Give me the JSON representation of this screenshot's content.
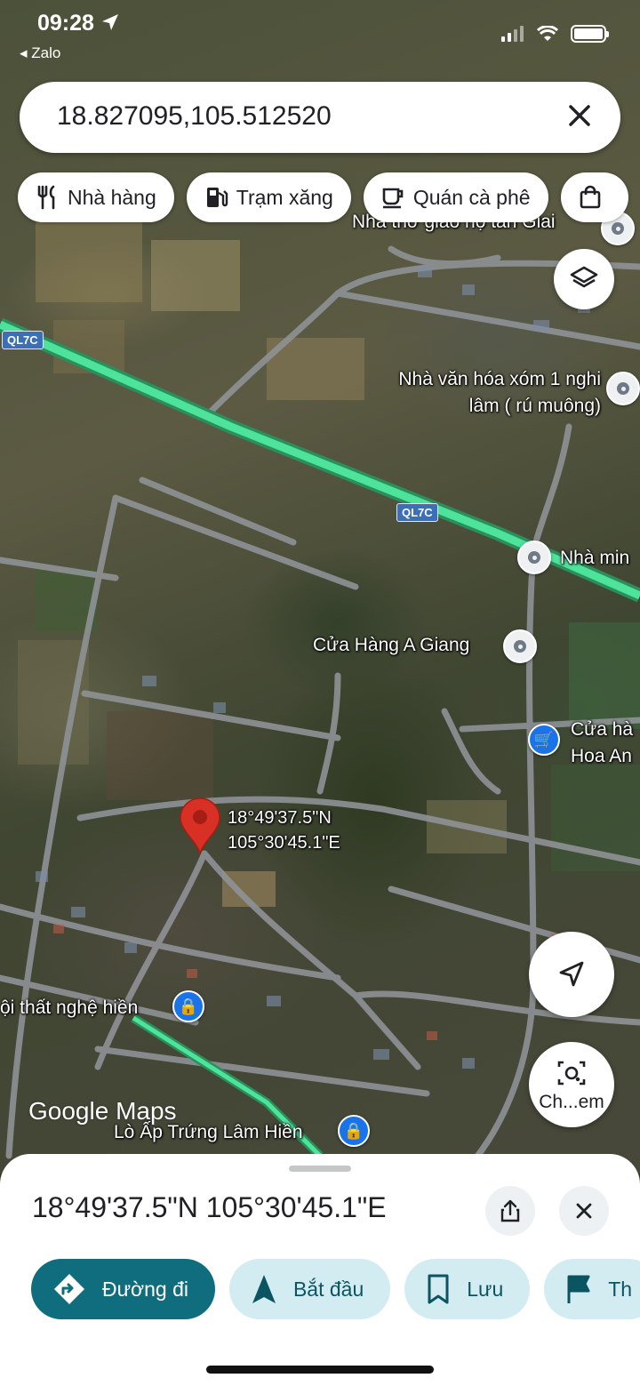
{
  "status_bar": {
    "time": "09:28",
    "back_app": "Zalo"
  },
  "search": {
    "query": "18.827095,105.512520"
  },
  "chips": [
    {
      "label": "Nhà hàng",
      "icon": "restaurant-icon"
    },
    {
      "label": "Trạm xăng",
      "icon": "gas-station-icon"
    },
    {
      "label": "Quán cà phê",
      "icon": "coffee-icon"
    },
    {
      "label": "",
      "icon": "shopping-bag-icon"
    }
  ],
  "map": {
    "road_labels": [
      "QL7C",
      "QL7C"
    ],
    "places": [
      "Nhà thờ giáo họ tân Giai",
      "Nhà văn hóa xóm 1 nghi lâm ( rú muông)",
      "Nhà min",
      "Cửa Hàng A Giang",
      "Cửa hà Hoa An",
      "ội thất nghệ hiền",
      "Lò Ấp Trứng Lâm Hiền"
    ],
    "pin_coordinates": [
      "18°49'37.5\"N",
      "105°30'45.1\"E"
    ],
    "attribution": "Google Maps",
    "explore_label": "Ch...em"
  },
  "sheet": {
    "title": "18°49'37.5\"N 105°30'45.1\"E",
    "actions": [
      {
        "label": "Đường đi",
        "icon": "directions-icon"
      },
      {
        "label": "Bắt đầu",
        "icon": "navigation-arrow-icon"
      },
      {
        "label": "Lưu",
        "icon": "bookmark-icon"
      },
      {
        "label": "Th",
        "icon": "flag-icon"
      }
    ]
  },
  "colors": {
    "primary": "#0f6d7d",
    "action_bg": "#d3ecf1",
    "road": "#3ecf8e",
    "pin": "#d93025"
  }
}
